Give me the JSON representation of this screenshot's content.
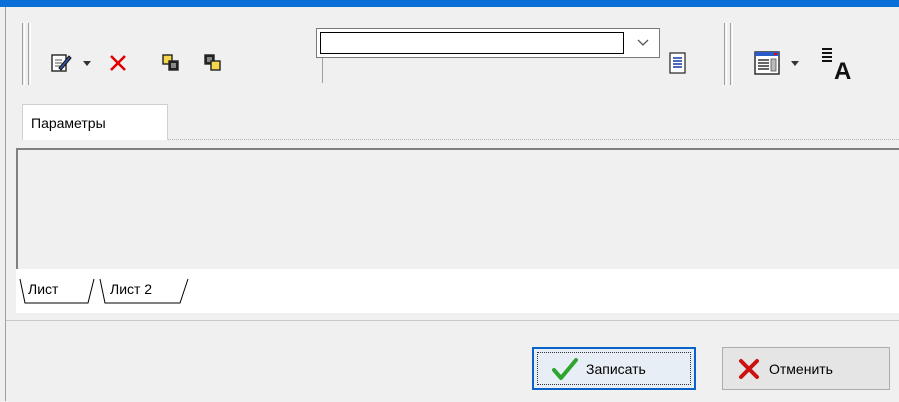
{
  "colors": {
    "title_bar": "#0b6fd8",
    "delete_red": "#e00000",
    "accept_green": "#2fa52f",
    "primary_border": "#0a64c8"
  },
  "toolbar": {
    "icons": [
      "edit-icon",
      "dropdown-caret",
      "delete-icon",
      "copy-icon",
      "paste-icon",
      "list-icon",
      "form-view-icon",
      "dropdown-caret",
      "font-icon"
    ],
    "combo_value": ""
  },
  "tabs": [
    {
      "label": "Параметры"
    }
  ],
  "sheets": [
    {
      "label": "Лист"
    },
    {
      "label": "Лист 2"
    }
  ],
  "footer": {
    "save_label": "Записать",
    "cancel_label": "Отменить"
  }
}
